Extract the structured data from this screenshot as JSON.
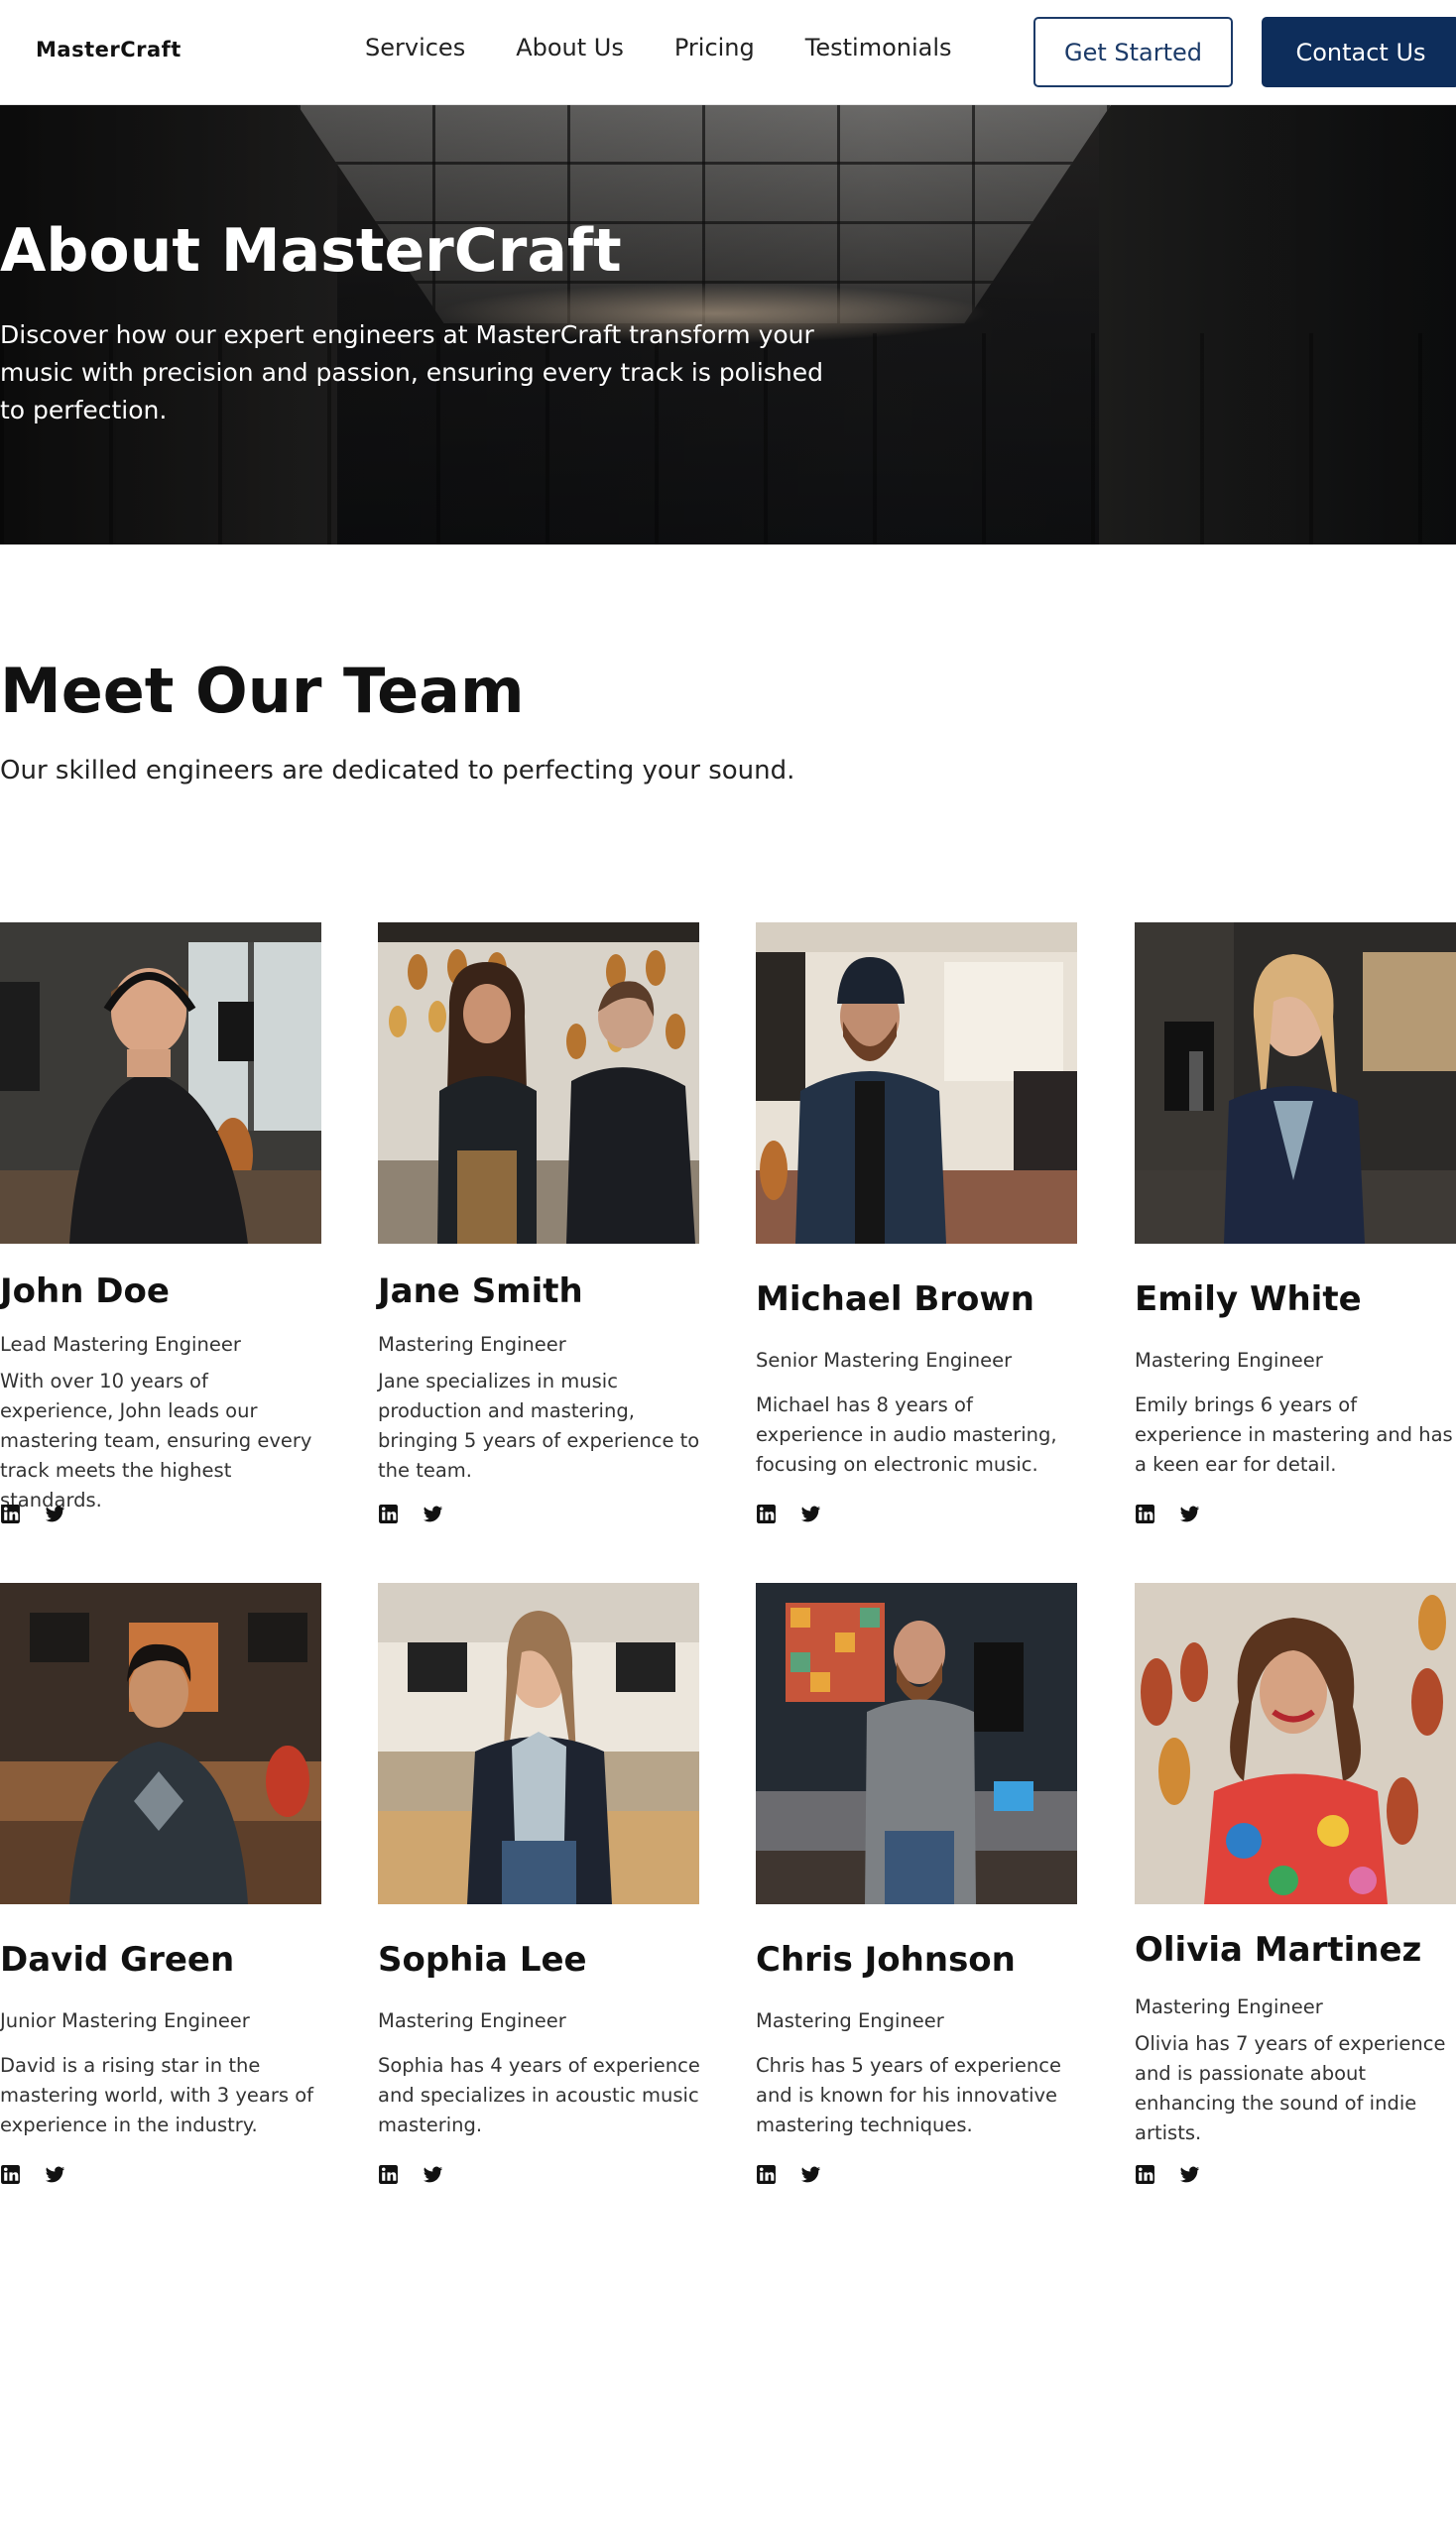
{
  "nav": {
    "logo": "MasterCraft",
    "links": [
      "Services",
      "About Us",
      "Pricing",
      "Testimonials"
    ],
    "get_started": "Get Started",
    "contact": "Contact Us"
  },
  "hero": {
    "title": "About MasterCraft",
    "text": "Discover how our expert engineers at MasterCraft transform your music with precision and passion, ensuring every track is polished to perfection."
  },
  "team": {
    "title": "Meet Our Team",
    "subtitle": "Our skilled engineers are dedicated to perfecting your sound.",
    "members": [
      {
        "name": "John Doe",
        "role": "Lead Mastering Engineer",
        "bio": "With over 10 years of experience, John leads our mastering team, ensuring every track meets the highest standards."
      },
      {
        "name": "Jane Smith",
        "role": "Mastering Engineer",
        "bio": "Jane specializes in music production and mastering, bringing 5 years of experience to the team."
      },
      {
        "name": "Michael Brown",
        "role": "Senior Mastering Engineer",
        "bio": "Michael has 8 years of experience in audio mastering, focusing on electronic music."
      },
      {
        "name": "Emily White",
        "role": "Mastering Engineer",
        "bio": "Emily brings 6 years of experience in mastering and has a keen ear for detail."
      },
      {
        "name": "David Green",
        "role": "Junior Mastering Engineer",
        "bio": "David is a rising star in the mastering world, with 3 years of experience in the industry."
      },
      {
        "name": "Sophia Lee",
        "role": "Mastering Engineer",
        "bio": "Sophia has 4 years of experience and specializes in acoustic music mastering."
      },
      {
        "name": "Chris Johnson",
        "role": "Mastering Engineer",
        "bio": "Chris has 5 years of experience and is known for his innovative mastering techniques."
      },
      {
        "name": "Olivia Martinez",
        "role": "Mastering Engineer",
        "bio": "Olivia has 7 years of experience and is passionate about enhancing the sound of indie artists."
      }
    ]
  },
  "icons": {
    "linkedin": "linkedin-icon",
    "twitter": "twitter-icon"
  }
}
